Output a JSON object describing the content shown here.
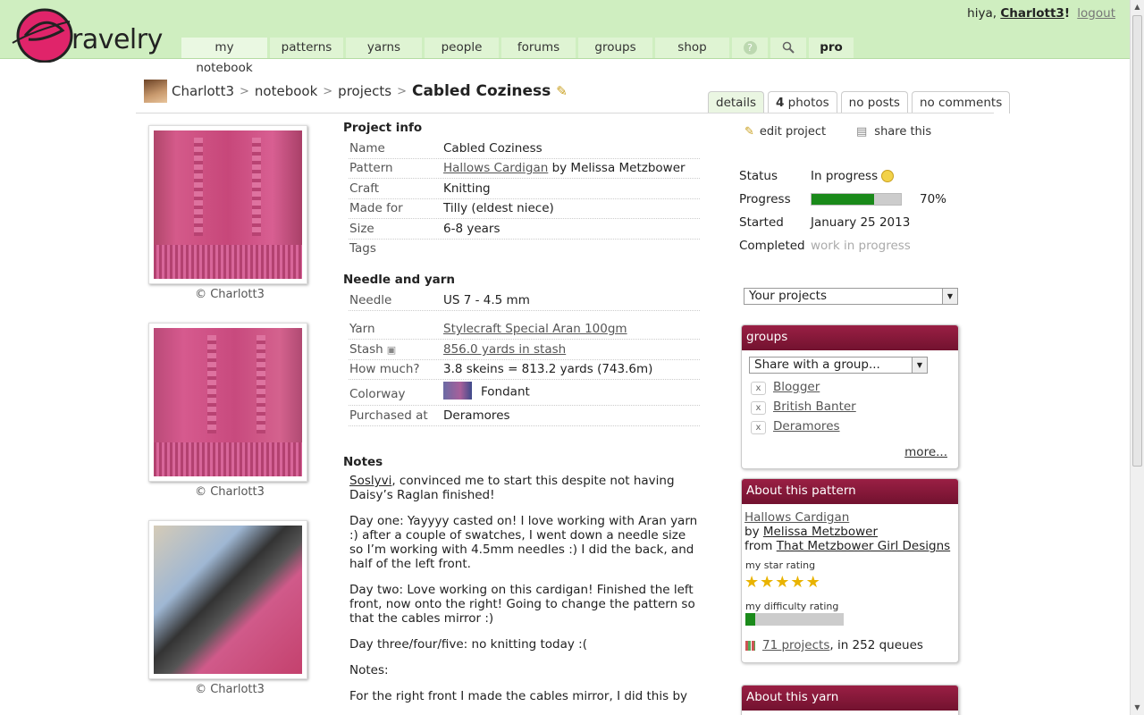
{
  "header": {
    "logo_text": "ravelry",
    "greeting": "hiya, ",
    "username": "Charlott3",
    "greeting_suffix": "!",
    "logout": "logout",
    "nav": [
      "my notebook",
      "patterns",
      "yarns",
      "people",
      "forums",
      "groups",
      "shop",
      "?",
      "search",
      "pro"
    ]
  },
  "breadcrumb": {
    "user": "Charlott3",
    "sep": ">",
    "notebook": "notebook",
    "projects": "projects",
    "title": "Cabled Coziness"
  },
  "tabs": {
    "details": "details",
    "photos_count": "4",
    "photos": " photos",
    "posts": "no posts",
    "comments": "no comments"
  },
  "photos": {
    "caption": "© Charlott3"
  },
  "project_info": {
    "heading": "Project info",
    "rows": [
      {
        "label": "Name",
        "value": "Cabled Coziness"
      },
      {
        "label": "Pattern",
        "value": "Hallows Cardigan",
        "suffix": " by Melissa Metzbower"
      },
      {
        "label": "Craft",
        "value": "Knitting"
      },
      {
        "label": "Made for",
        "value": "Tilly (eldest niece)"
      },
      {
        "label": "Size",
        "value": "6-8 years"
      },
      {
        "label": "Tags",
        "value": ""
      }
    ]
  },
  "needle_yarn": {
    "heading": "Needle and yarn",
    "needle_label": "Needle",
    "needle_value": "US 7 - 4.5 mm",
    "yarn_label": "Yarn",
    "yarn_value": "Stylecraft Special Aran 100gm",
    "stash_label": "Stash",
    "stash_value": "856.0 yards in stash",
    "howmuch_label": "How much?",
    "howmuch_value": "3.8 skeins = 813.2 yards (743.6m)",
    "colorway_label": "Colorway",
    "colorway_value": "Fondant",
    "purchased_label": "Purchased at",
    "purchased_value": "Deramores"
  },
  "notes": {
    "heading": "Notes",
    "first_link": "Soslyvi",
    "first_rest": ", convinced me to start this despite not having Daisy’s Raglan finished!",
    "p2": "Day one: Yayyyy casted on! I love working with Aran yarn :) after a couple of swatches, I went down a needle size so I’m working with 4.5mm needles :) I did the back, and half of the left front.",
    "p3": "Day two: Love working on this cardigan! Finished the left front, now onto the right! Going to change the pattern so that the cables mirror :)",
    "p4": "Day three/four/five: no knitting today :(",
    "p5": "Notes:",
    "p6": "For the right front I made the cables mirror, I did this by"
  },
  "actions": {
    "edit": "edit project",
    "share": "share this"
  },
  "status": {
    "status_label": "Status",
    "status_value": "In progress",
    "progress_label": "Progress",
    "progress_percent": 70,
    "progress_text": "70%",
    "started_label": "Started",
    "started_value": "January 25 2013",
    "completed_label": "Completed",
    "completed_value": "work in progress"
  },
  "your_projects": "Your projects",
  "groups_box": {
    "heading": "groups",
    "select": "Share with a group...",
    "items": [
      "Blogger",
      "British Banter",
      "Deramores"
    ],
    "more": "more..."
  },
  "pattern_box": {
    "heading": "About this pattern",
    "pattern": "Hallows Cardigan",
    "by_prefix": "by ",
    "designer": "Melissa Metzbower",
    "from_prefix": "from ",
    "source": "That Metzbower Girl Designs",
    "star_label": "my star rating",
    "stars": 5,
    "difficulty_label": "my difficulty rating",
    "difficulty_fraction": 0.1,
    "projects_link": "71 projects",
    "queues": ", in 252 queues"
  },
  "yarn_box": {
    "heading": "About this yarn"
  },
  "colors": {
    "header_bg": "#cfeec0",
    "box_header": "#8a1a3c",
    "progress_fill": "#1a8a1a"
  }
}
